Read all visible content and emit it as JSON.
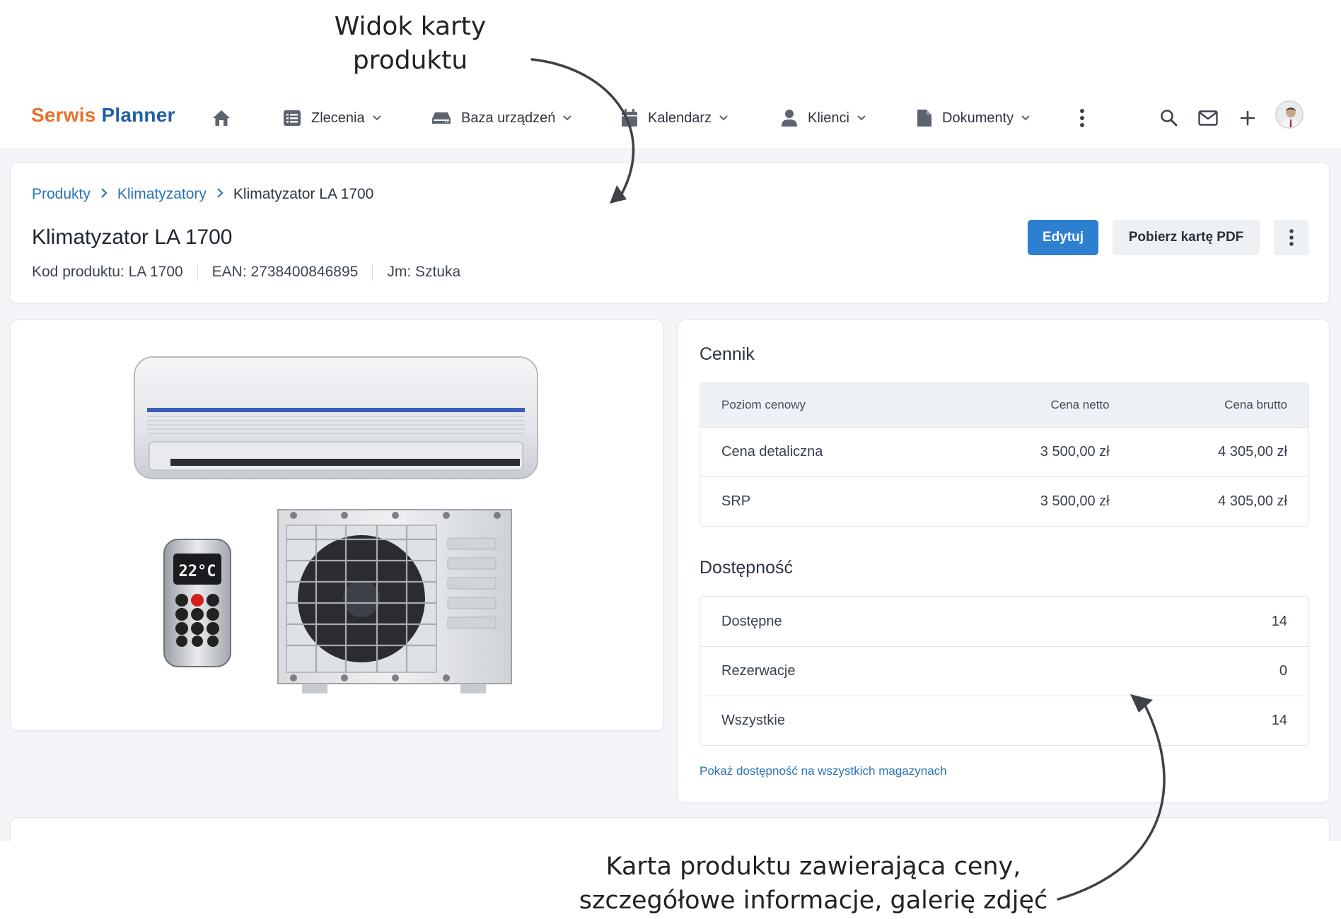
{
  "annotations": {
    "top_line1": "Widok karty",
    "top_line2": "produktu",
    "bottom_line1": "Karta produktu zawierająca ceny,",
    "bottom_line2": "szczegółowe informacje, galerię zdjęć"
  },
  "logo": {
    "part1": "Serwis",
    "part2": "Planner"
  },
  "nav": {
    "home_icon": "home-icon",
    "items": [
      {
        "label": "Zlecenia",
        "icon": "list-icon"
      },
      {
        "label": "Baza urządzeń",
        "icon": "device-icon"
      },
      {
        "label": "Kalendarz",
        "icon": "calendar-icon"
      },
      {
        "label": "Klienci",
        "icon": "user-icon"
      },
      {
        "label": "Dokumenty",
        "icon": "document-icon"
      }
    ],
    "right_icons": [
      "search-icon",
      "mail-icon",
      "plus-icon",
      "avatar"
    ]
  },
  "breadcrumb": {
    "items": [
      "Produkty",
      "Klimatyzatory"
    ],
    "current": "Klimatyzator LA 1700"
  },
  "product": {
    "title": "Klimatyzator LA 1700",
    "code": "Kod produktu: LA 1700",
    "ean": "EAN: 2738400846895",
    "unit": "Jm: Sztuka"
  },
  "actions": {
    "edit": "Edytuj",
    "pdf": "Pobierz kartę PDF"
  },
  "pricing": {
    "title": "Cennik",
    "columns": [
      "Poziom cenowy",
      "Cena netto",
      "Cena brutto"
    ],
    "rows": [
      {
        "level": "Cena detaliczna",
        "net": "3 500,00 zł",
        "gross": "4 305,00 zł"
      },
      {
        "level": "SRP",
        "net": "3 500,00 zł",
        "gross": "4 305,00 zł"
      }
    ]
  },
  "availability": {
    "title": "Dostępność",
    "rows": [
      {
        "label": "Dostępne",
        "value": "14"
      },
      {
        "label": "Rezerwacje",
        "value": "0"
      },
      {
        "label": "Wszystkie",
        "value": "14"
      }
    ],
    "link": "Pokaż dostępność na wszystkich magazynach"
  },
  "remote_display": "22°C",
  "colors": {
    "logo_orange": "#e8702a",
    "logo_blue": "#1f5fa8",
    "primary": "#2f7fd0",
    "link": "#2a72b5"
  }
}
